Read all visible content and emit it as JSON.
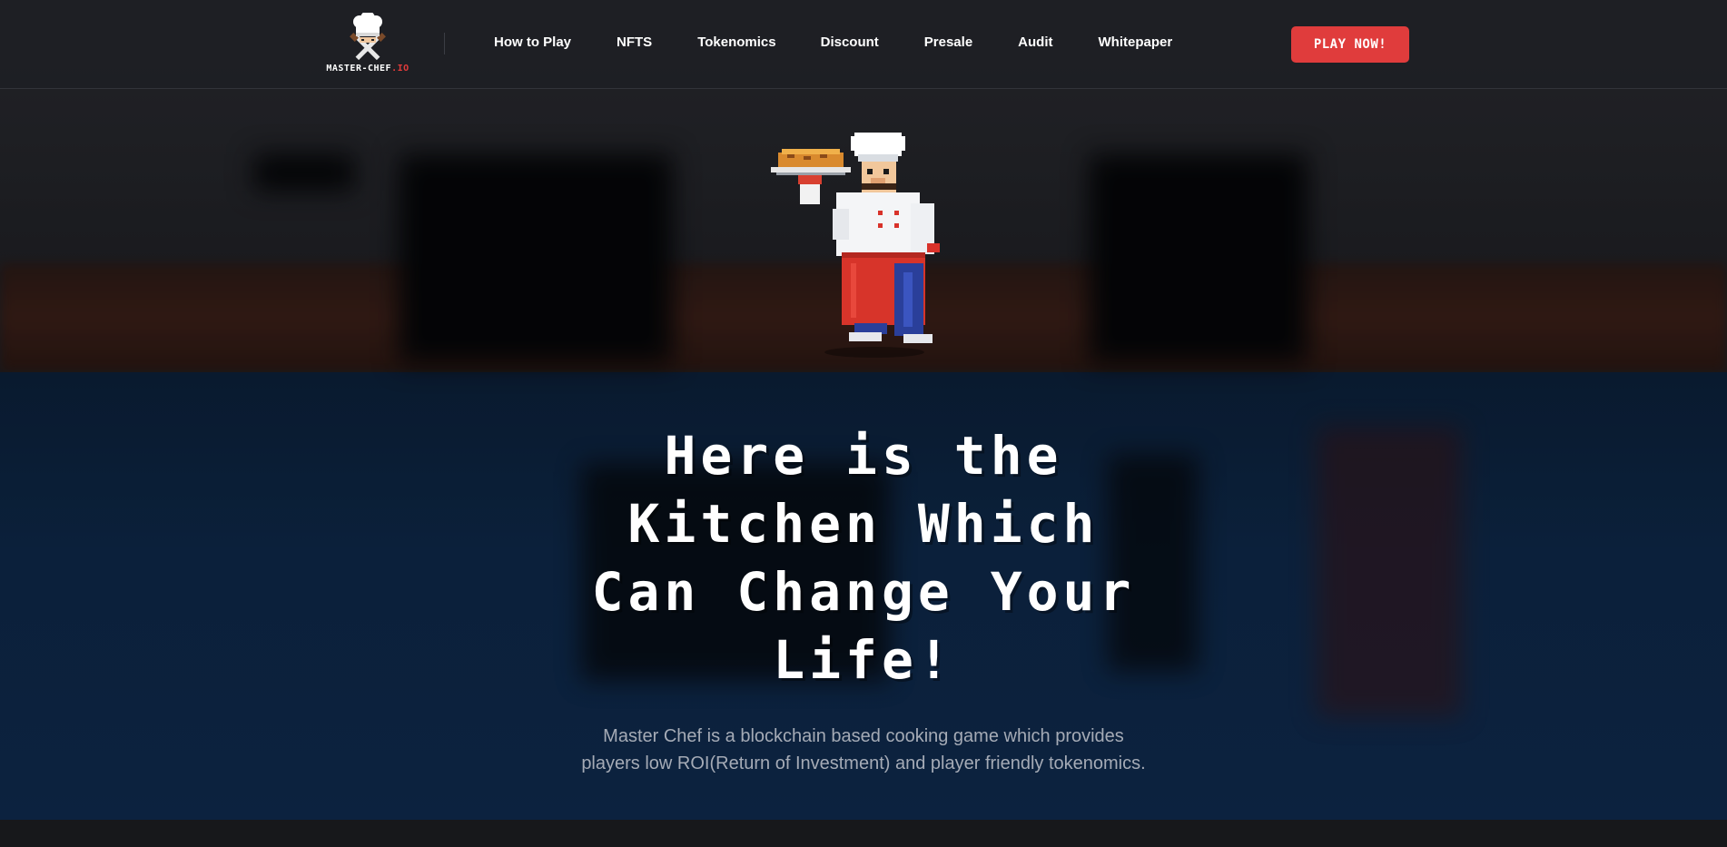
{
  "header": {
    "logo": {
      "text": "MASTER-CHEF",
      "suffix": ".IO",
      "icon": "chef-hat-crossed-knives-icon"
    },
    "nav": [
      {
        "label": "How to Play"
      },
      {
        "label": "NFTS"
      },
      {
        "label": "Tokenomics"
      },
      {
        "label": "Discount"
      },
      {
        "label": "Presale"
      },
      {
        "label": "Audit"
      },
      {
        "label": "Whitepaper"
      }
    ],
    "cta_label": "PLAY NOW!"
  },
  "hero": {
    "illustration": "pixel-chef-holding-pie-icon",
    "headline_lines": [
      "Here is the",
      "Kitchen Which",
      "Can Change Your",
      "Life!"
    ],
    "subtitle_lines": [
      "Master Chef is a blockchain based cooking game which provides",
      "players low ROI(Return of Investment) and player friendly tokenomics."
    ]
  },
  "colors": {
    "header_bg": "#1e1f24",
    "accent_red": "#e03c3c",
    "text_white": "#ffffff",
    "subtitle_gray": "#a5abb6",
    "hero_blue": "#0e2848"
  }
}
